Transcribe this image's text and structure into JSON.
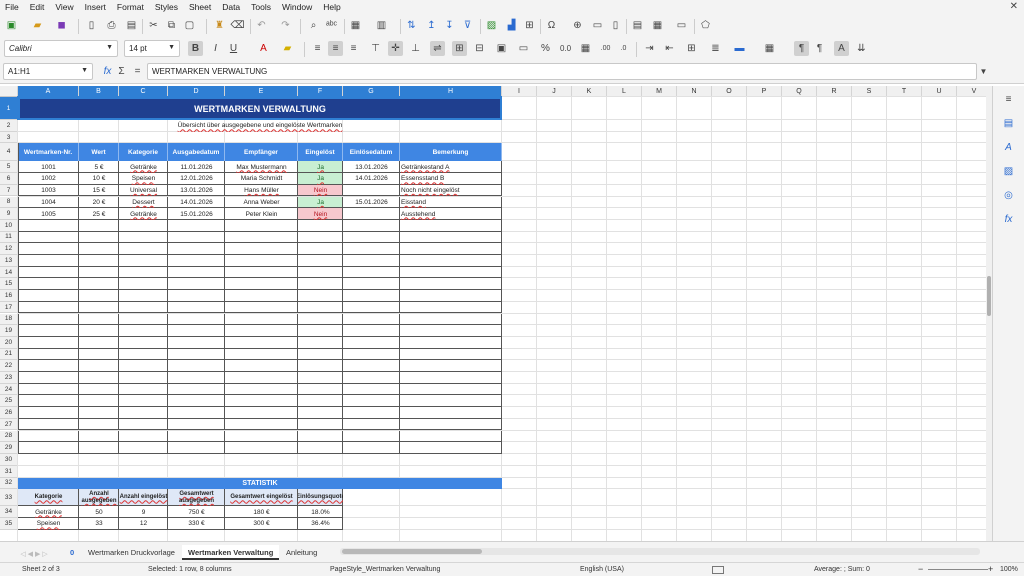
{
  "menu": [
    "File",
    "Edit",
    "View",
    "Insert",
    "Format",
    "Styles",
    "Sheet",
    "Data",
    "Tools",
    "Window",
    "Help"
  ],
  "toolbar": {
    "font_name": "Calibri",
    "font_size": "14 pt",
    "bold": "B",
    "italic": "I",
    "underline": "U",
    "percent": "%",
    "decimal": "0.0",
    "decimal2": ".00"
  },
  "formula_bar": {
    "name_box": "A1:H1",
    "fx": "fx",
    "sigma": "Σ",
    "equals": "=",
    "content": "WERTMARKEN VERWALTUNG"
  },
  "columns": [
    "A",
    "B",
    "C",
    "D",
    "E",
    "F",
    "G",
    "H",
    "I",
    "J",
    "K",
    "L",
    "M",
    "N",
    "O",
    "P",
    "Q",
    "R",
    "S",
    "T",
    "U",
    "V"
  ],
  "rows": [
    "1",
    "2",
    "3",
    "4",
    "5",
    "6",
    "7",
    "8",
    "9",
    "10",
    "11",
    "12",
    "13",
    "14",
    "15",
    "16",
    "17",
    "18",
    "19",
    "20",
    "21",
    "22",
    "23",
    "24",
    "25",
    "26",
    "27",
    "28",
    "29",
    "30",
    "31",
    "32",
    "33",
    "34",
    "35"
  ],
  "sheet": {
    "title": "WERTMARKEN VERWALTUNG",
    "subtitle": "Übersicht über ausgegebene und eingelöste Wertmarken",
    "headers": [
      "Wertmarken-Nr.",
      "Wert",
      "Kategorie",
      "Ausgabedatum",
      "Empfänger",
      "Eingelöst",
      "Einlösedatum",
      "Bemerkung"
    ],
    "data": [
      [
        "1001",
        "5 €",
        "Getränke",
        "11.01.2026",
        "Max Mustermann",
        "Ja",
        "13.01.2026",
        "Getränkestand A"
      ],
      [
        "1002",
        "10 €",
        "Speisen",
        "12.01.2026",
        "Maria Schmidt",
        "Ja",
        "14.01.2026",
        "Essensstand B"
      ],
      [
        "1003",
        "15 €",
        "Universal",
        "13.01.2026",
        "Hans Müller",
        "Nein",
        "",
        "Noch nicht eingelöst"
      ],
      [
        "1004",
        "20 €",
        "Dessert",
        "14.01.2026",
        "Anna Weber",
        "Ja",
        "15.01.2026",
        "Eisstand"
      ],
      [
        "1005",
        "25 €",
        "Getränke",
        "15.01.2026",
        "Peter Klein",
        "Nein",
        "",
        "Ausstehend"
      ]
    ],
    "stats_title": "STATISTIK",
    "stats_headers": [
      "Kategorie",
      "Anzahl ausgegeben",
      "Anzahl eingelöst",
      "Gesamtwert ausgegeben",
      "Gesamtwert eingelöst",
      "Einlösungsquote"
    ],
    "stats_rows": [
      [
        "Getränke",
        "50",
        "9",
        "750 €",
        "180 €",
        "18.0%"
      ],
      [
        "Speisen",
        "33",
        "12",
        "330 €",
        "300 €",
        "36.4%"
      ]
    ]
  },
  "tabs": [
    "Wertmarken Druckvorlage",
    "Wertmarken Verwaltung",
    "Anleitung"
  ],
  "active_tab": "Wertmarken Verwaltung",
  "tab_zero": "0",
  "status": {
    "sheet": "Sheet 2 of 3",
    "selection": "Selected: 1 row, 8 columns",
    "page_style": "PageStyle_Wertmarken Verwaltung",
    "language": "English (USA)",
    "summary": "Average: ; Sum: 0",
    "zoom": "100%"
  }
}
